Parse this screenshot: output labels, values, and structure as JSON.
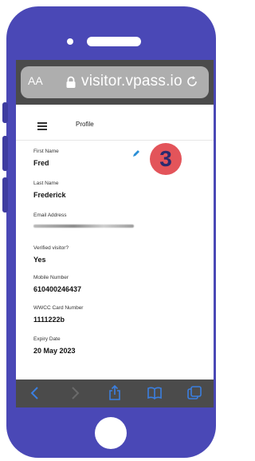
{
  "browser": {
    "text_size_label": "AA",
    "url": "visitor.vpass.io"
  },
  "app": {
    "title": "Profile"
  },
  "profile": {
    "fields": [
      {
        "label": "First Name",
        "value": "Fred"
      },
      {
        "label": "Last Name",
        "value": "Frederick"
      },
      {
        "label": "Email Address",
        "value": ""
      },
      {
        "label": "Verified visitor?",
        "value": "Yes"
      },
      {
        "label": "Mobile Number",
        "value": "610400246437"
      },
      {
        "label": "WWCC Card Number",
        "value": "1111222b"
      },
      {
        "label": "Expiry Date",
        "value": "20 May 2023"
      }
    ]
  },
  "step_badge": "3",
  "colors": {
    "phone_body": "#4a48b6",
    "browser_chrome": "#4b4b4b",
    "url_field": "#aeaeae",
    "badge": "#e3545a",
    "edit_icon": "#2a8fd6",
    "toolbar_icons": "#3b7fe0"
  },
  "icons": [
    "lock-icon",
    "reload-icon",
    "menu-icon",
    "edit-icon",
    "back-icon",
    "forward-icon",
    "share-icon",
    "bookmarks-icon",
    "tabs-icon"
  ]
}
